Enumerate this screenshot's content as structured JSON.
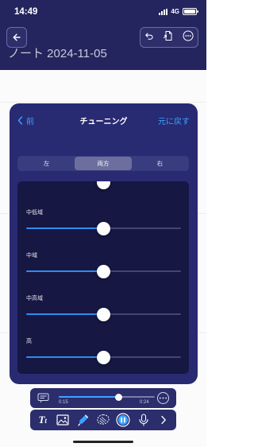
{
  "status": {
    "time": "14:49",
    "network": "4G"
  },
  "note": {
    "title": "ノート 2024-11-05"
  },
  "tuning": {
    "back_label": "前",
    "title": "チューニング",
    "reset_label": "元に戻す",
    "channels": [
      {
        "label": "左",
        "active": false
      },
      {
        "label": "両方",
        "active": true
      },
      {
        "label": "右",
        "active": false
      }
    ],
    "bands": [
      {
        "label": "中低域",
        "level": 0.5
      },
      {
        "label": "中域",
        "level": 0.5
      },
      {
        "label": "中高域",
        "level": 0.5
      },
      {
        "label": "高",
        "level": 0.5
      }
    ]
  },
  "player": {
    "elapsed": "0:15",
    "total": "0:24",
    "progress": 0.62
  },
  "colors": {
    "accent": "#3da2ff",
    "panel": "#282a72",
    "header": "#24255e",
    "slider_fill": "#2e8cf0"
  },
  "toolbar_icons": [
    "text-format-icon",
    "image-icon",
    "pen-icon",
    "lasso-icon",
    "audio-record-icon",
    "microphone-icon",
    "chevron-right-icon"
  ]
}
